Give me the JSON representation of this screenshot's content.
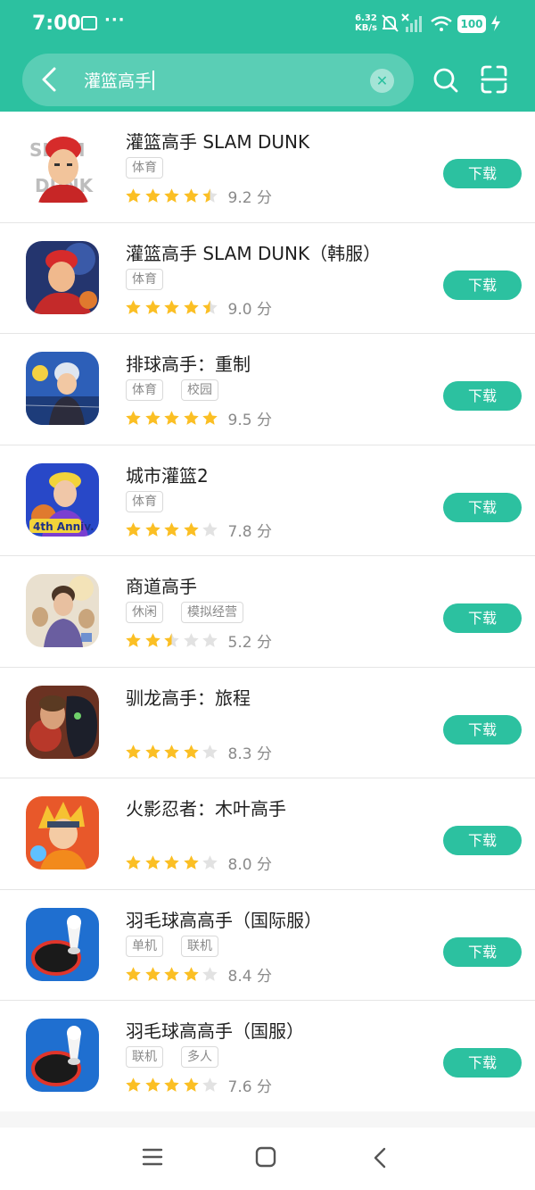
{
  "status_bar": {
    "time": "7:00",
    "more": "···",
    "speed_value": "6.32",
    "speed_unit": "KB/s",
    "battery": "100"
  },
  "search": {
    "query": "灌篮高手"
  },
  "colors": {
    "accent": "#2cc1a0",
    "star_filled": "#fbbf24",
    "star_empty": "#e2e2e2"
  },
  "download_label": "下载",
  "apps": [
    {
      "name": "灌篮高手 SLAM DUNK",
      "tags": [
        "体育"
      ],
      "rating": 4.5,
      "score": "9.2 分",
      "icon": "slam-dunk-icon"
    },
    {
      "name": "灌篮高手 SLAM DUNK（韩服）",
      "tags": [
        "体育"
      ],
      "rating": 4.5,
      "score": "9.0 分",
      "icon": "slam-dunk-kr-icon"
    },
    {
      "name": "排球高手：重制",
      "tags": [
        "体育",
        "校园"
      ],
      "rating": 5,
      "score": "9.5 分",
      "icon": "volleyball-icon"
    },
    {
      "name": "城市灌篮2",
      "tags": [
        "体育"
      ],
      "rating": 4,
      "score": "7.8 分",
      "icon": "city-dunk-icon"
    },
    {
      "name": "商道高手",
      "tags": [
        "休闲",
        "模拟经营"
      ],
      "rating": 2.5,
      "score": "5.2 分",
      "icon": "business-master-icon"
    },
    {
      "name": "驯龙高手：旅程",
      "tags": [],
      "rating": 4,
      "score": "8.3 分",
      "icon": "dragon-trainer-icon"
    },
    {
      "name": "火影忍者：木叶高手",
      "tags": [],
      "rating": 4,
      "score": "8.0 分",
      "icon": "naruto-icon"
    },
    {
      "name": "羽毛球高高手（国际服）",
      "tags": [
        "单机",
        "联机"
      ],
      "rating": 4,
      "score": "8.4 分",
      "icon": "badminton-global-icon"
    },
    {
      "name": "羽毛球高高手（国服）",
      "tags": [
        "联机",
        "多人"
      ],
      "rating": 4,
      "score": "7.6 分",
      "icon": "badminton-cn-icon"
    }
  ]
}
